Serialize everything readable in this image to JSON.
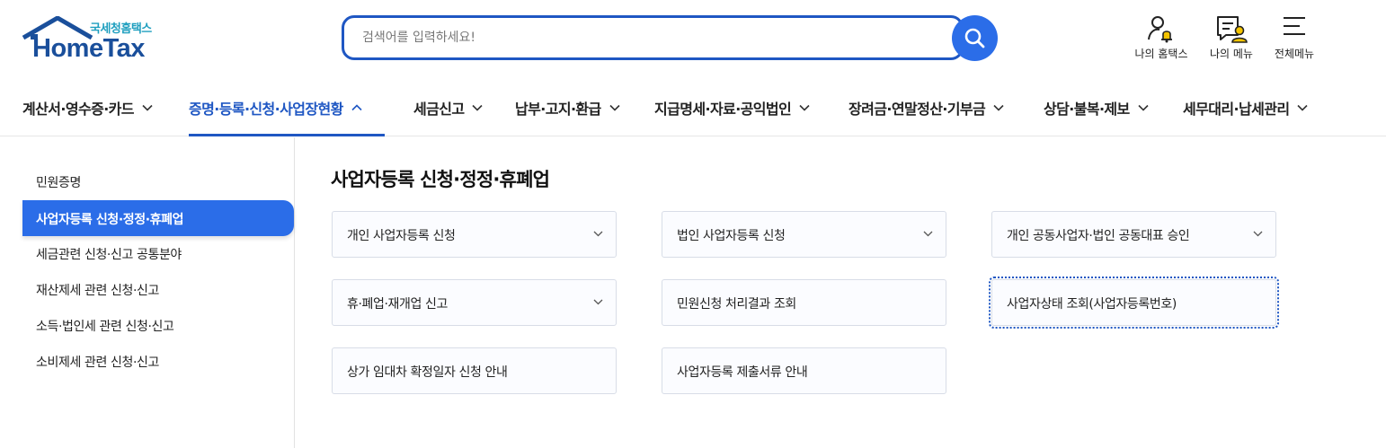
{
  "logo": {
    "small_text": "국세청홈택스",
    "big_text": "HomeTax"
  },
  "search": {
    "placeholder": "검색어를 입력하세요!"
  },
  "utility": {
    "my_hometax": "나의 홈택스",
    "my_menu": "나의 메뉴",
    "all_menu": "전체메뉴"
  },
  "gnb": {
    "items": [
      "계산서·영수증·카드",
      "증명·등록·신청·사업장현황",
      "세금신고",
      "납부·고지·환급",
      "지급명세·자료·공익법인",
      "장려금·연말정산·기부금",
      "상담·불복·제보",
      "세무대리·납세관리"
    ],
    "active_index": 1
  },
  "side": {
    "items": [
      "민원증명",
      "사업자등록 신청·정정·휴폐업",
      "세금관련 신청·신고 공통분야",
      "재산제세 관련 신청·신고",
      "소득·법인세 관련 신청·신고",
      "소비제세 관련 신청·신고"
    ],
    "active_index": 1
  },
  "main": {
    "title": "사업자등록 신청·정정·휴폐업",
    "cards": [
      {
        "label": "개인 사업자등록 신청",
        "expandable": true
      },
      {
        "label": "법인 사업자등록 신청",
        "expandable": true
      },
      {
        "label": "개인 공동사업자·법인 공동대표 승인",
        "expandable": true
      },
      {
        "label": "휴·폐업·재개업 신고",
        "expandable": true
      },
      {
        "label": "민원신청 처리결과 조회",
        "expandable": false
      },
      {
        "label": "사업자상태 조회(사업자등록번호)",
        "expandable": false
      },
      {
        "label": "상가 임대차 확정일자 신청 안내",
        "expandable": false
      },
      {
        "label": "사업자등록 제출서류 안내",
        "expandable": false
      }
    ]
  },
  "colors": {
    "brand_blue": "#1f57c3",
    "button_blue": "#2b6de8",
    "logo_navy": "#1a4f9b",
    "logo_teal": "#1f9fbf",
    "bell_yellow": "#f5c400"
  },
  "icons": [
    "search-icon",
    "user-bell-icon",
    "menu-person-icon",
    "hamburger-icon",
    "chevron-down-icon",
    "chevron-up-icon"
  ]
}
